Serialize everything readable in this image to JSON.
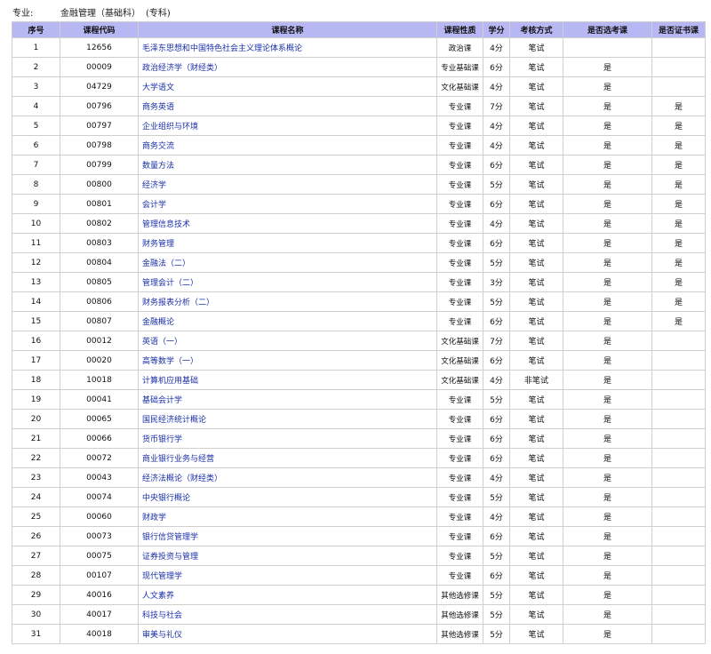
{
  "header": {
    "label": "专业:",
    "major": "金融管理（基础科）",
    "level": "(专科)"
  },
  "columns": [
    "序号",
    "课程代码",
    "课程名称",
    "课程性质",
    "学分",
    "考核方式",
    "是否选考课",
    "是否证书课"
  ],
  "rows": [
    [
      "1",
      "12656",
      "毛泽东思想和中国特色社会主义理论体系概论",
      "政治课",
      "4分",
      "笔试",
      "",
      ""
    ],
    [
      "2",
      "00009",
      "政治经济学（财经类）",
      "专业基础课",
      "6分",
      "笔试",
      "是",
      ""
    ],
    [
      "3",
      "04729",
      "大学语文",
      "文化基础课",
      "4分",
      "笔试",
      "是",
      ""
    ],
    [
      "4",
      "00796",
      "商务英语",
      "专业课",
      "7分",
      "笔试",
      "是",
      "是"
    ],
    [
      "5",
      "00797",
      "企业组织与环境",
      "专业课",
      "4分",
      "笔试",
      "是",
      "是"
    ],
    [
      "6",
      "00798",
      "商务交流",
      "专业课",
      "4分",
      "笔试",
      "是",
      "是"
    ],
    [
      "7",
      "00799",
      "数量方法",
      "专业课",
      "6分",
      "笔试",
      "是",
      "是"
    ],
    [
      "8",
      "00800",
      "经济学",
      "专业课",
      "5分",
      "笔试",
      "是",
      "是"
    ],
    [
      "9",
      "00801",
      "会计学",
      "专业课",
      "6分",
      "笔试",
      "是",
      "是"
    ],
    [
      "10",
      "00802",
      "管理信息技术",
      "专业课",
      "4分",
      "笔试",
      "是",
      "是"
    ],
    [
      "11",
      "00803",
      "财务管理",
      "专业课",
      "6分",
      "笔试",
      "是",
      "是"
    ],
    [
      "12",
      "00804",
      "金融法（二）",
      "专业课",
      "5分",
      "笔试",
      "是",
      "是"
    ],
    [
      "13",
      "00805",
      "管理会计（二）",
      "专业课",
      "3分",
      "笔试",
      "是",
      "是"
    ],
    [
      "14",
      "00806",
      "财务报表分析（二）",
      "专业课",
      "5分",
      "笔试",
      "是",
      "是"
    ],
    [
      "15",
      "00807",
      "金融概论",
      "专业课",
      "6分",
      "笔试",
      "是",
      "是"
    ],
    [
      "16",
      "00012",
      "英语（一）",
      "文化基础课",
      "7分",
      "笔试",
      "是",
      ""
    ],
    [
      "17",
      "00020",
      "高等数学（一）",
      "文化基础课",
      "6分",
      "笔试",
      "是",
      ""
    ],
    [
      "18",
      "10018",
      "计算机应用基础",
      "文化基础课",
      "4分",
      "非笔试",
      "是",
      ""
    ],
    [
      "19",
      "00041",
      "基础会计学",
      "专业课",
      "5分",
      "笔试",
      "是",
      ""
    ],
    [
      "20",
      "00065",
      "国民经济统计概论",
      "专业课",
      "6分",
      "笔试",
      "是",
      ""
    ],
    [
      "21",
      "00066",
      "货币银行学",
      "专业课",
      "6分",
      "笔试",
      "是",
      ""
    ],
    [
      "22",
      "00072",
      "商业银行业务与经营",
      "专业课",
      "6分",
      "笔试",
      "是",
      ""
    ],
    [
      "23",
      "00043",
      "经济法概论（财经类）",
      "专业课",
      "4分",
      "笔试",
      "是",
      ""
    ],
    [
      "24",
      "00074",
      "中央银行概论",
      "专业课",
      "5分",
      "笔试",
      "是",
      ""
    ],
    [
      "25",
      "00060",
      "财政学",
      "专业课",
      "4分",
      "笔试",
      "是",
      ""
    ],
    [
      "26",
      "00073",
      "银行信贷管理学",
      "专业课",
      "6分",
      "笔试",
      "是",
      ""
    ],
    [
      "27",
      "00075",
      "证券投资与管理",
      "专业课",
      "5分",
      "笔试",
      "是",
      ""
    ],
    [
      "28",
      "00107",
      "现代管理学",
      "专业课",
      "6分",
      "笔试",
      "是",
      ""
    ],
    [
      "29",
      "40016",
      "人文素养",
      "其他选修课",
      "5分",
      "笔试",
      "是",
      ""
    ],
    [
      "30",
      "40017",
      "科技与社会",
      "其他选修课",
      "5分",
      "笔试",
      "是",
      ""
    ],
    [
      "31",
      "40018",
      "审美与礼仪",
      "其他选修课",
      "5分",
      "笔试",
      "是",
      ""
    ]
  ]
}
